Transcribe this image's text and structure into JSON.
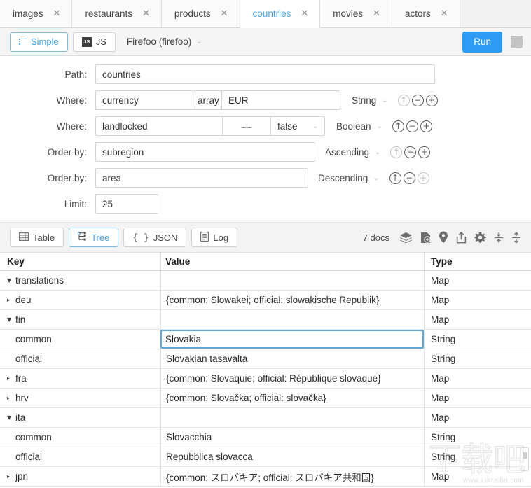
{
  "tabs": [
    {
      "label": "images",
      "active": false
    },
    {
      "label": "restaurants",
      "active": false
    },
    {
      "label": "products",
      "active": false
    },
    {
      "label": "countries",
      "active": true
    },
    {
      "label": "movies",
      "active": false
    },
    {
      "label": "actors",
      "active": false
    }
  ],
  "tab_close_glyph": "✕",
  "actionbar": {
    "simple_label": "Simple",
    "js_label": "JS",
    "js_icon_text": "JS",
    "connection": "Firefoo (firefoo)",
    "connection_caret": "⌄",
    "run_label": "Run"
  },
  "query": {
    "rows": [
      {
        "kind": "path",
        "label": "Path:",
        "value": "countries"
      },
      {
        "kind": "where",
        "label": "Where:",
        "field": "currency",
        "operator": "array",
        "value": "EUR",
        "type": "String",
        "type_caret": "⌄",
        "up_disabled": true,
        "plus_disabled": false
      },
      {
        "kind": "where",
        "label": "Where:",
        "field": "landlocked",
        "operator": "==",
        "value": "false",
        "value_caret": "⌄",
        "type": "Boolean",
        "type_caret": "⌄",
        "up_disabled": false,
        "plus_disabled": false
      },
      {
        "kind": "order",
        "label": "Order by:",
        "field": "subregion",
        "direction": "Ascending",
        "dir_caret": "⌄",
        "up_disabled": true,
        "plus_disabled": false
      },
      {
        "kind": "order",
        "label": "Order by:",
        "field": "area",
        "direction": "Descending",
        "dir_caret": "⌄",
        "up_disabled": false,
        "plus_disabled": true
      },
      {
        "kind": "limit",
        "label": "Limit:",
        "value": "25"
      }
    ],
    "ctl_up": "↑",
    "ctl_minus": "−",
    "ctl_plus": "+"
  },
  "results": {
    "views": [
      {
        "label": "Table",
        "icon": "table-icon",
        "active": false
      },
      {
        "label": "Tree",
        "icon": "tree-icon",
        "active": true
      },
      {
        "label": "JSON",
        "icon": "braces-icon",
        "active": false
      },
      {
        "label": "Log",
        "icon": "log-icon",
        "active": false
      }
    ],
    "json_icon_text": "{ }",
    "doc_count": "7 docs",
    "toolbar_icons": [
      "layers-icon",
      "add-document-icon",
      "map-pin-icon",
      "share-export-icon",
      "gear-icon",
      "collapse-all-icon",
      "expand-all-icon"
    ],
    "columns": [
      "Key",
      "Value",
      "Type"
    ],
    "rows": [
      {
        "indent": 0,
        "twisty": "down",
        "key": "translations",
        "value": "",
        "type": "Map",
        "selected": false
      },
      {
        "indent": 1,
        "twisty": "right",
        "key": "deu",
        "value": "{common: Slowakei; official: slowakische Republik}",
        "type": "Map",
        "selected": false
      },
      {
        "indent": 1,
        "twisty": "down",
        "key": "fin",
        "value": "",
        "type": "Map",
        "selected": false
      },
      {
        "indent": 2,
        "twisty": "none",
        "key": "common",
        "value": "Slovakia",
        "type": "String",
        "selected": true
      },
      {
        "indent": 2,
        "twisty": "none",
        "key": "official",
        "value": "Slovakian tasavalta",
        "type": "String",
        "selected": false
      },
      {
        "indent": 1,
        "twisty": "right",
        "key": "fra",
        "value": "{common: Slovaquie; official: République slovaque}",
        "type": "Map",
        "selected": false
      },
      {
        "indent": 1,
        "twisty": "right",
        "key": "hrv",
        "value": "{common: Slovačka; official: slovačka}",
        "type": "Map",
        "selected": false
      },
      {
        "indent": 1,
        "twisty": "down",
        "key": "ita",
        "value": "",
        "type": "Map",
        "selected": false
      },
      {
        "indent": 2,
        "twisty": "none",
        "key": "common",
        "value": "Slovacchia",
        "type": "String",
        "selected": false
      },
      {
        "indent": 2,
        "twisty": "none",
        "key": "official",
        "value": "Repubblica slovacca",
        "type": "String",
        "selected": false
      },
      {
        "indent": 1,
        "twisty": "right",
        "key": "jpn",
        "value": "{common: スロバキア; official: スロバキア共和国}",
        "type": "Map",
        "selected": false
      }
    ],
    "twisty_down": "▼",
    "twisty_right": "▸"
  },
  "watermark": {
    "cjk": "下载吧",
    "url": "www.xiazaiba.com"
  },
  "colors": {
    "accent": "#4aa3e3",
    "run_button": "#2f9bf5",
    "selection_border": "#5fa8d3",
    "toolbar_bg": "#f3f3f3"
  }
}
